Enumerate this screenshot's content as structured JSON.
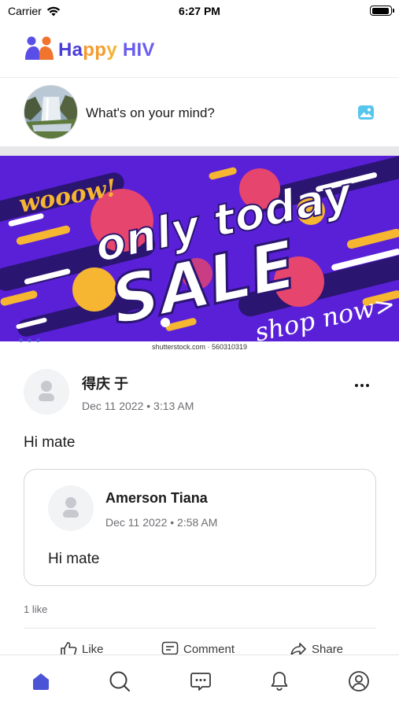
{
  "status_bar": {
    "carrier": "Carrier",
    "time": "6:27 PM"
  },
  "header": {
    "app_name_parts": [
      "Ha",
      "pp",
      "y",
      " HIV"
    ],
    "logo_icon": "happy-hiv-logo",
    "colors": {
      "brand_purple": "#4a3fd6",
      "brand_orange": "#f79a2a",
      "accent_blue": "#4c54d6"
    }
  },
  "composer": {
    "prompt": "What's on your mind?",
    "photo_icon": "image-icon"
  },
  "banner": {
    "texts": {
      "wooow": "wooow!",
      "only_today": "only today",
      "sale": "SALE",
      "shop_now": "shop now>"
    },
    "caption": "shutterstock.com · 560310319"
  },
  "post": {
    "author": "得庆 于",
    "date": "Dec 11 2022",
    "time": "3:13 AM",
    "text": "Hi mate",
    "shared": {
      "author": "Amerson Tiana",
      "date": "Dec 11 2022",
      "time": "2:58 AM",
      "text": "Hi mate"
    },
    "likes": "1 like",
    "actions": {
      "like": "Like",
      "comment": "Comment",
      "share": "Share"
    }
  },
  "tab_bar": {
    "tabs": [
      {
        "icon": "home-icon",
        "active": true
      },
      {
        "icon": "search-icon",
        "active": false
      },
      {
        "icon": "chat-icon",
        "active": false
      },
      {
        "icon": "bell-icon",
        "active": false
      },
      {
        "icon": "profile-icon",
        "active": false
      }
    ]
  }
}
